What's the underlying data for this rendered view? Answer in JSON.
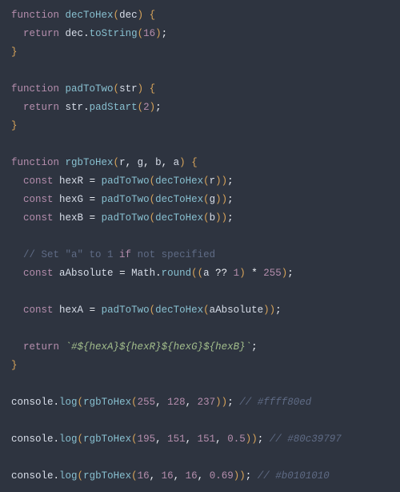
{
  "code": {
    "lines": [
      [
        {
          "c": "kw",
          "t": "function"
        },
        {
          "c": "pun",
          "t": " "
        },
        {
          "c": "fn",
          "t": "decToHex"
        },
        {
          "c": "paren",
          "t": "("
        },
        {
          "c": "id",
          "t": "dec"
        },
        {
          "c": "paren",
          "t": ")"
        },
        {
          "c": "pun",
          "t": " "
        },
        {
          "c": "paren",
          "t": "{"
        }
      ],
      [
        {
          "c": "pun",
          "t": "  "
        },
        {
          "c": "kw",
          "t": "return"
        },
        {
          "c": "pun",
          "t": " "
        },
        {
          "c": "id",
          "t": "dec"
        },
        {
          "c": "pun",
          "t": "."
        },
        {
          "c": "fn",
          "t": "toString"
        },
        {
          "c": "paren",
          "t": "("
        },
        {
          "c": "num",
          "t": "16"
        },
        {
          "c": "paren",
          "t": ")"
        },
        {
          "c": "pun",
          "t": ";"
        }
      ],
      [
        {
          "c": "paren",
          "t": "}"
        }
      ],
      [
        {
          "c": "pun",
          "t": ""
        }
      ],
      [
        {
          "c": "kw",
          "t": "function"
        },
        {
          "c": "pun",
          "t": " "
        },
        {
          "c": "fn",
          "t": "padToTwo"
        },
        {
          "c": "paren",
          "t": "("
        },
        {
          "c": "id",
          "t": "str"
        },
        {
          "c": "paren",
          "t": ")"
        },
        {
          "c": "pun",
          "t": " "
        },
        {
          "c": "paren",
          "t": "{"
        }
      ],
      [
        {
          "c": "pun",
          "t": "  "
        },
        {
          "c": "kw",
          "t": "return"
        },
        {
          "c": "pun",
          "t": " "
        },
        {
          "c": "id",
          "t": "str"
        },
        {
          "c": "pun",
          "t": "."
        },
        {
          "c": "fn",
          "t": "padStart"
        },
        {
          "c": "paren",
          "t": "("
        },
        {
          "c": "num",
          "t": "2"
        },
        {
          "c": "paren",
          "t": ")"
        },
        {
          "c": "pun",
          "t": ";"
        }
      ],
      [
        {
          "c": "paren",
          "t": "}"
        }
      ],
      [
        {
          "c": "pun",
          "t": ""
        }
      ],
      [
        {
          "c": "kw",
          "t": "function"
        },
        {
          "c": "pun",
          "t": " "
        },
        {
          "c": "fn",
          "t": "rgbToHex"
        },
        {
          "c": "paren",
          "t": "("
        },
        {
          "c": "id",
          "t": "r"
        },
        {
          "c": "pun",
          "t": ", "
        },
        {
          "c": "id",
          "t": "g"
        },
        {
          "c": "pun",
          "t": ", "
        },
        {
          "c": "id",
          "t": "b"
        },
        {
          "c": "pun",
          "t": ", "
        },
        {
          "c": "id",
          "t": "a"
        },
        {
          "c": "paren",
          "t": ")"
        },
        {
          "c": "pun",
          "t": " "
        },
        {
          "c": "paren",
          "t": "{"
        }
      ],
      [
        {
          "c": "pun",
          "t": "  "
        },
        {
          "c": "kw",
          "t": "const"
        },
        {
          "c": "pun",
          "t": " "
        },
        {
          "c": "id",
          "t": "hexR"
        },
        {
          "c": "pun",
          "t": " = "
        },
        {
          "c": "fn",
          "t": "padToTwo"
        },
        {
          "c": "paren",
          "t": "("
        },
        {
          "c": "fn",
          "t": "decToHex"
        },
        {
          "c": "paren",
          "t": "("
        },
        {
          "c": "id",
          "t": "r"
        },
        {
          "c": "paren",
          "t": "))"
        },
        {
          "c": "pun",
          "t": ";"
        }
      ],
      [
        {
          "c": "pun",
          "t": "  "
        },
        {
          "c": "kw",
          "t": "const"
        },
        {
          "c": "pun",
          "t": " "
        },
        {
          "c": "id",
          "t": "hexG"
        },
        {
          "c": "pun",
          "t": " = "
        },
        {
          "c": "fn",
          "t": "padToTwo"
        },
        {
          "c": "paren",
          "t": "("
        },
        {
          "c": "fn",
          "t": "decToHex"
        },
        {
          "c": "paren",
          "t": "("
        },
        {
          "c": "id",
          "t": "g"
        },
        {
          "c": "paren",
          "t": "))"
        },
        {
          "c": "pun",
          "t": ";"
        }
      ],
      [
        {
          "c": "pun",
          "t": "  "
        },
        {
          "c": "kw",
          "t": "const"
        },
        {
          "c": "pun",
          "t": " "
        },
        {
          "c": "id",
          "t": "hexB"
        },
        {
          "c": "pun",
          "t": " = "
        },
        {
          "c": "fn",
          "t": "padToTwo"
        },
        {
          "c": "paren",
          "t": "("
        },
        {
          "c": "fn",
          "t": "decToHex"
        },
        {
          "c": "paren",
          "t": "("
        },
        {
          "c": "id",
          "t": "b"
        },
        {
          "c": "paren",
          "t": "))"
        },
        {
          "c": "pun",
          "t": ";"
        }
      ],
      [
        {
          "c": "pun",
          "t": ""
        }
      ],
      [
        {
          "c": "pun",
          "t": "  "
        },
        {
          "c": "cmt",
          "t": "// Set \"a\" to 1 "
        },
        {
          "c": "kw",
          "t": "if"
        },
        {
          "c": "cmt",
          "t": " not specified"
        }
      ],
      [
        {
          "c": "pun",
          "t": "  "
        },
        {
          "c": "kw",
          "t": "const"
        },
        {
          "c": "pun",
          "t": " "
        },
        {
          "c": "id",
          "t": "aAbsolute"
        },
        {
          "c": "pun",
          "t": " = "
        },
        {
          "c": "id",
          "t": "Math"
        },
        {
          "c": "pun",
          "t": "."
        },
        {
          "c": "fn",
          "t": "round"
        },
        {
          "c": "paren",
          "t": "(("
        },
        {
          "c": "id",
          "t": "a"
        },
        {
          "c": "pun",
          "t": " ?? "
        },
        {
          "c": "num",
          "t": "1"
        },
        {
          "c": "paren",
          "t": ")"
        },
        {
          "c": "pun",
          "t": " * "
        },
        {
          "c": "num",
          "t": "255"
        },
        {
          "c": "paren",
          "t": ")"
        },
        {
          "c": "pun",
          "t": ";"
        }
      ],
      [
        {
          "c": "pun",
          "t": ""
        }
      ],
      [
        {
          "c": "pun",
          "t": "  "
        },
        {
          "c": "kw",
          "t": "const"
        },
        {
          "c": "pun",
          "t": " "
        },
        {
          "c": "id",
          "t": "hexA"
        },
        {
          "c": "pun",
          "t": " = "
        },
        {
          "c": "fn",
          "t": "padToTwo"
        },
        {
          "c": "paren",
          "t": "("
        },
        {
          "c": "fn",
          "t": "decToHex"
        },
        {
          "c": "paren",
          "t": "("
        },
        {
          "c": "id",
          "t": "aAbsolute"
        },
        {
          "c": "paren",
          "t": "))"
        },
        {
          "c": "pun",
          "t": ";"
        }
      ],
      [
        {
          "c": "pun",
          "t": ""
        }
      ],
      [
        {
          "c": "pun",
          "t": "  "
        },
        {
          "c": "kw",
          "t": "return"
        },
        {
          "c": "pun",
          "t": " "
        },
        {
          "c": "tpl",
          "t": "`#${hexA}${hexR}${hexG}${hexB}`"
        },
        {
          "c": "pun",
          "t": ";"
        }
      ],
      [
        {
          "c": "paren",
          "t": "}"
        }
      ],
      [
        {
          "c": "pun",
          "t": ""
        }
      ],
      [
        {
          "c": "id",
          "t": "console"
        },
        {
          "c": "pun",
          "t": "."
        },
        {
          "c": "fn",
          "t": "log"
        },
        {
          "c": "paren",
          "t": "("
        },
        {
          "c": "fn",
          "t": "rgbToHex"
        },
        {
          "c": "paren",
          "t": "("
        },
        {
          "c": "num",
          "t": "255"
        },
        {
          "c": "pun",
          "t": ", "
        },
        {
          "c": "num",
          "t": "128"
        },
        {
          "c": "pun",
          "t": ", "
        },
        {
          "c": "num",
          "t": "237"
        },
        {
          "c": "paren",
          "t": "))"
        },
        {
          "c": "pun",
          "t": "; "
        },
        {
          "c": "cmt-i",
          "t": "// #ffff80ed"
        }
      ],
      [
        {
          "c": "pun",
          "t": ""
        }
      ],
      [
        {
          "c": "id",
          "t": "console"
        },
        {
          "c": "pun",
          "t": "."
        },
        {
          "c": "fn",
          "t": "log"
        },
        {
          "c": "paren",
          "t": "("
        },
        {
          "c": "fn",
          "t": "rgbToHex"
        },
        {
          "c": "paren",
          "t": "("
        },
        {
          "c": "num",
          "t": "195"
        },
        {
          "c": "pun",
          "t": ", "
        },
        {
          "c": "num",
          "t": "151"
        },
        {
          "c": "pun",
          "t": ", "
        },
        {
          "c": "num",
          "t": "151"
        },
        {
          "c": "pun",
          "t": ", "
        },
        {
          "c": "num",
          "t": "0.5"
        },
        {
          "c": "paren",
          "t": "))"
        },
        {
          "c": "pun",
          "t": "; "
        },
        {
          "c": "cmt-i",
          "t": "// #80c39797"
        }
      ],
      [
        {
          "c": "pun",
          "t": ""
        }
      ],
      [
        {
          "c": "id",
          "t": "console"
        },
        {
          "c": "pun",
          "t": "."
        },
        {
          "c": "fn",
          "t": "log"
        },
        {
          "c": "paren",
          "t": "("
        },
        {
          "c": "fn",
          "t": "rgbToHex"
        },
        {
          "c": "paren",
          "t": "("
        },
        {
          "c": "num",
          "t": "16"
        },
        {
          "c": "pun",
          "t": ", "
        },
        {
          "c": "num",
          "t": "16"
        },
        {
          "c": "pun",
          "t": ", "
        },
        {
          "c": "num",
          "t": "16"
        },
        {
          "c": "pun",
          "t": ", "
        },
        {
          "c": "num",
          "t": "0.69"
        },
        {
          "c": "paren",
          "t": "))"
        },
        {
          "c": "pun",
          "t": "; "
        },
        {
          "c": "cmt-i",
          "t": "// #b0101010"
        }
      ]
    ]
  }
}
